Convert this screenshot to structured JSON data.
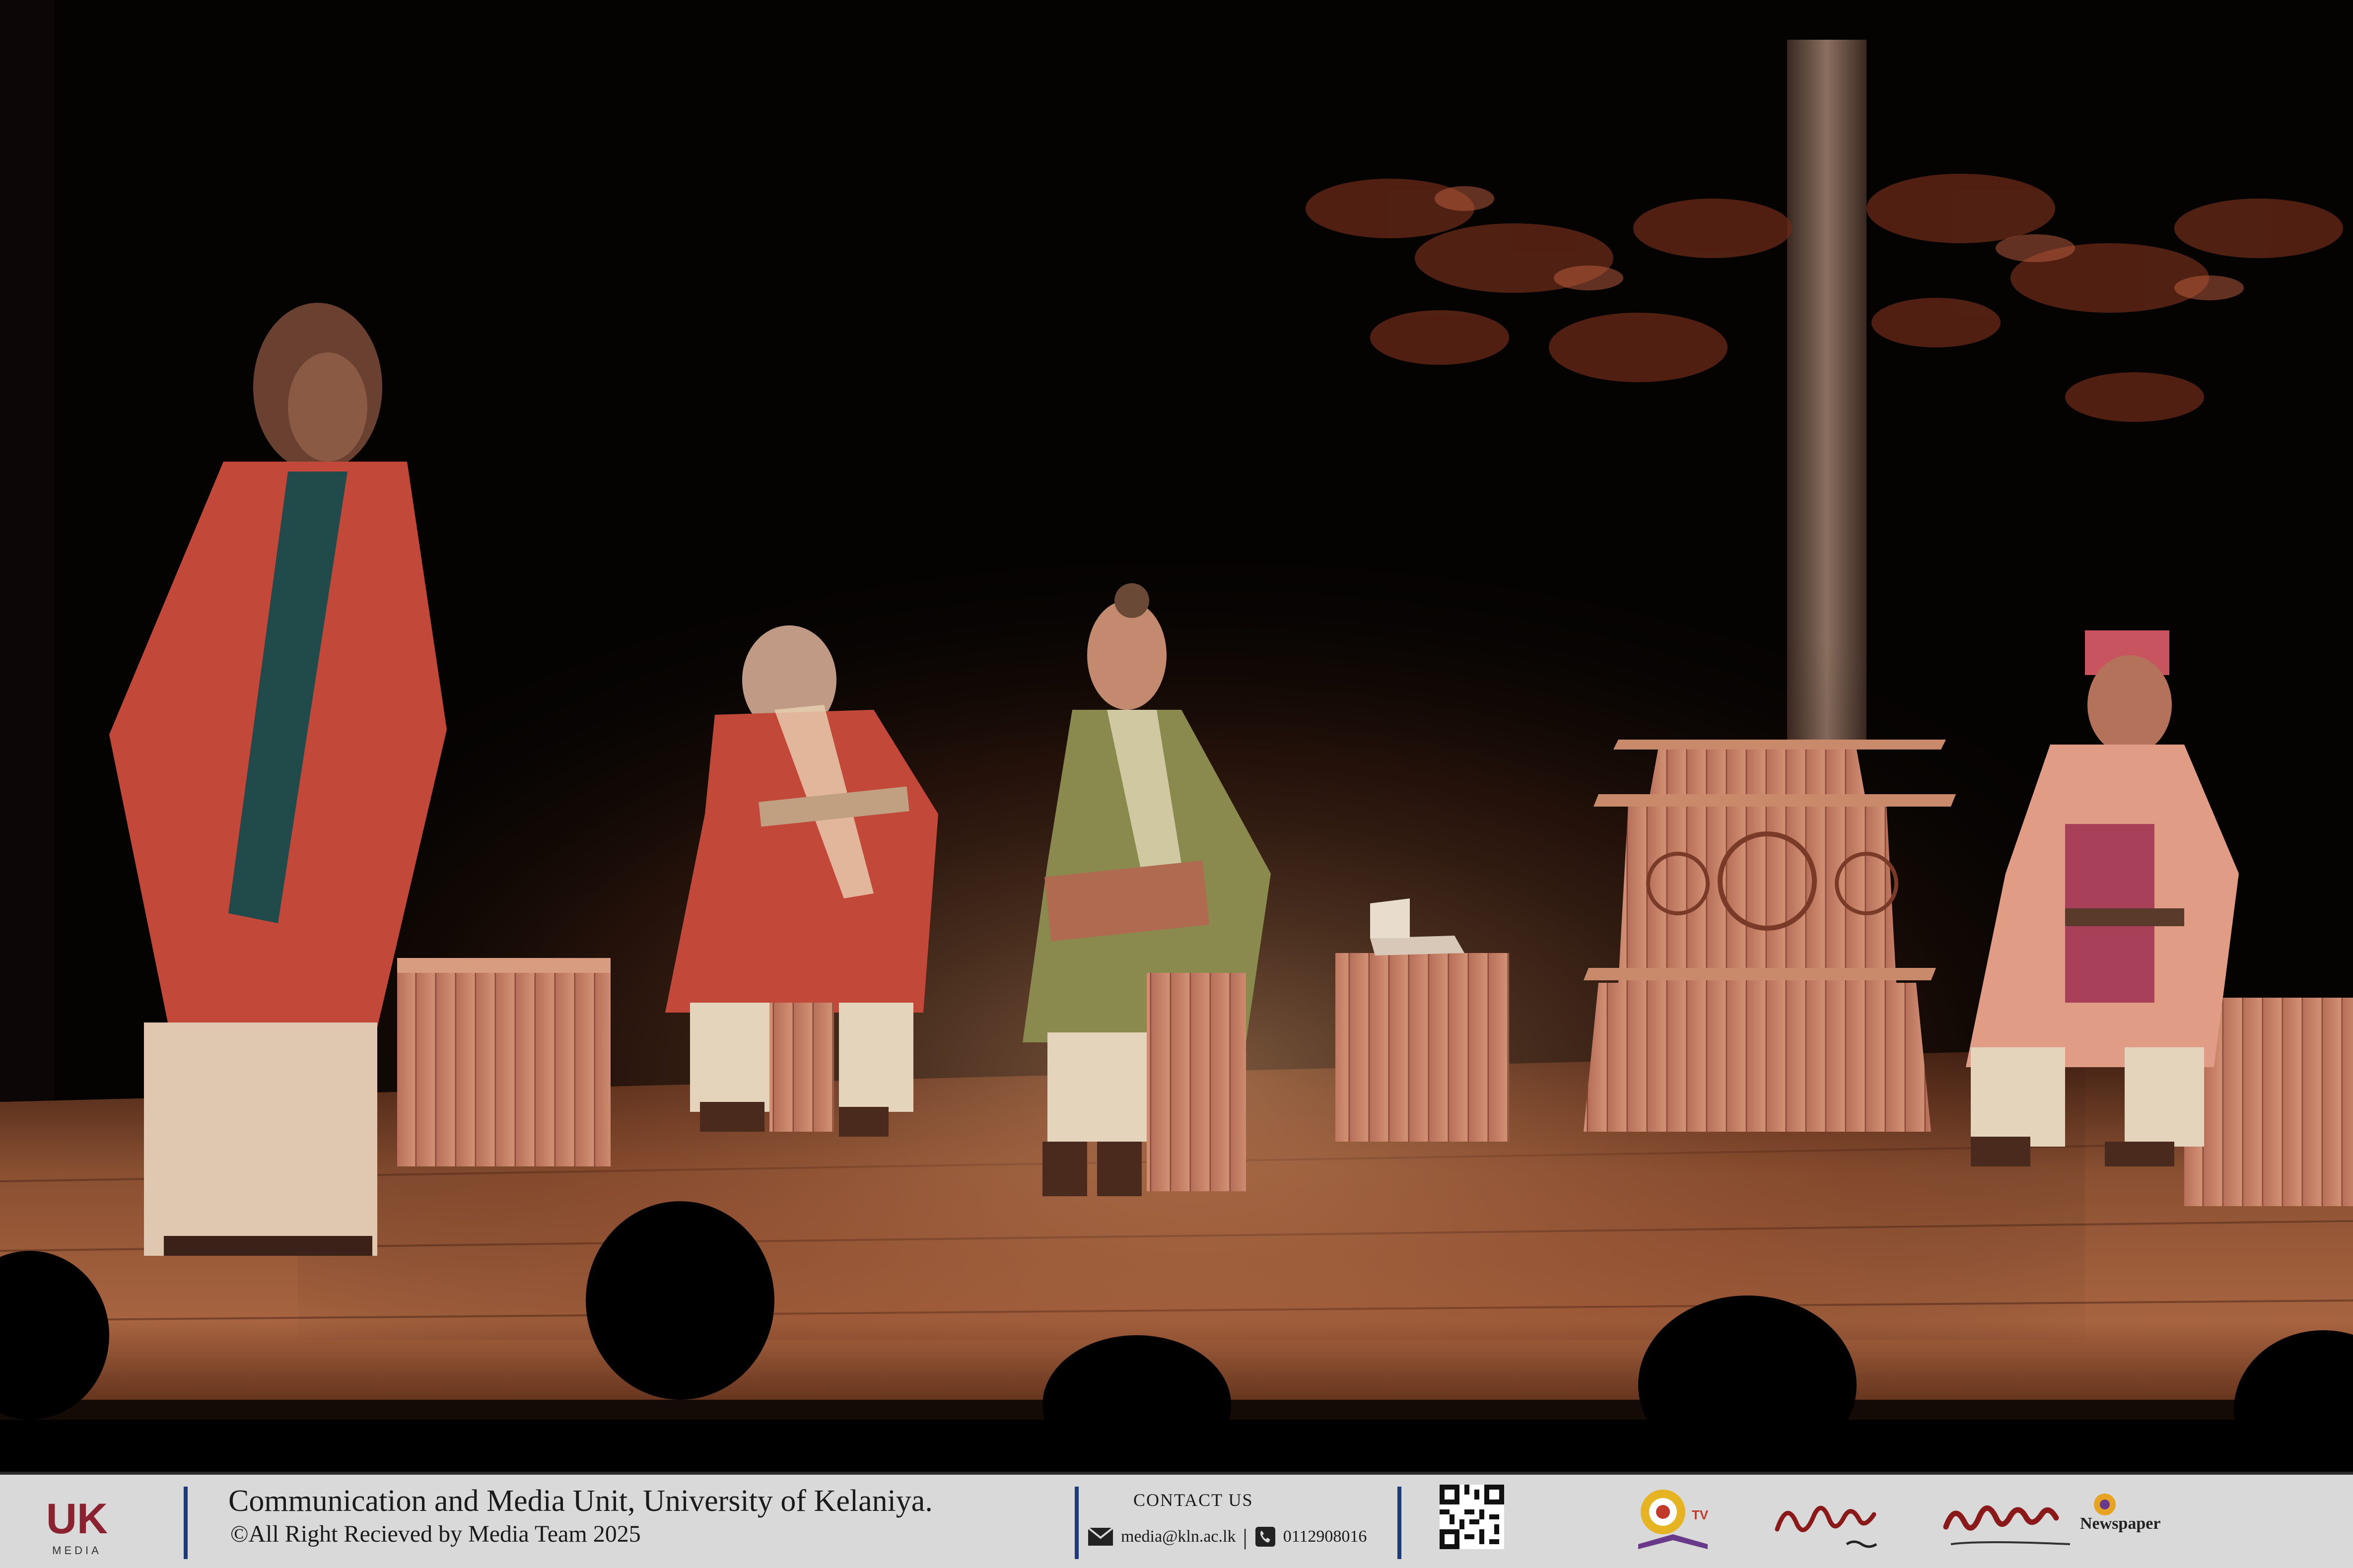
{
  "photo": {
    "subject": "stage-play",
    "colors": {
      "stage_floor": "#9a5a3a",
      "spotlight": "#e0a070",
      "background": "#050302",
      "robe_red": "#c2483a",
      "robe_olive": "#8a8a4e"
    }
  },
  "footer": {
    "org_line1": "Communication and Media Unit, University of Kelaniya.",
    "org_line2": "©All Right Recieved by Media Team 2025",
    "logo_letters": "UK",
    "logo_caption": "MEDIA",
    "contact_title": "CONTACT US",
    "email": "media@kln.ac.lk",
    "separator": "|",
    "phone": "0112908016",
    "brand_tv_text": "TV",
    "brand_newspaper_label": "Newspaper",
    "icons": [
      "uk-media-logo",
      "mail-icon",
      "phone-icon",
      "qr-code",
      "tv-channel-logo",
      "script-brand-logo",
      "newspaper-logo"
    ],
    "accent_color": "#1d3b78"
  }
}
